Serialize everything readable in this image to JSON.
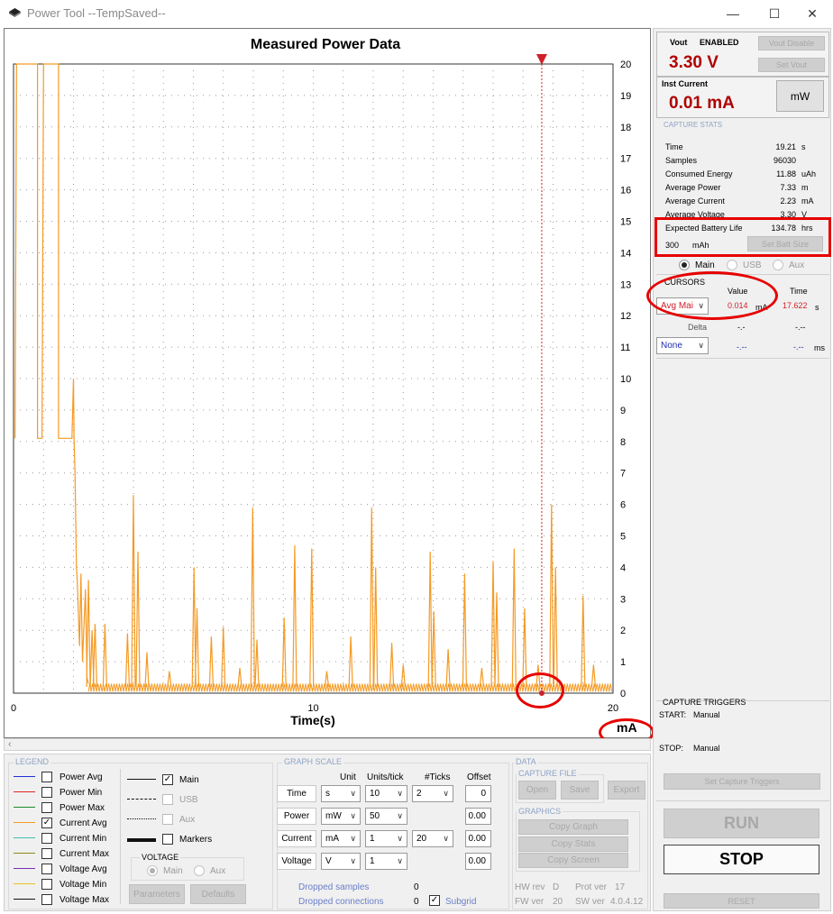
{
  "window": {
    "title": "Power Tool --TempSaved--",
    "minimize": "—",
    "maximize": "☐",
    "close": "✕"
  },
  "graph": {
    "title": "Measured Power Data",
    "unit_label": "mA",
    "x_title": "Time(s)"
  },
  "chart_data": {
    "type": "line",
    "title": "Measured Power Data",
    "xlabel": "Time(s)",
    "ylabel": "mA",
    "xlim": [
      0,
      20
    ],
    "ylim": [
      0,
      20
    ],
    "x_ticks": [
      "0",
      "10",
      "20"
    ],
    "y_ticks": [
      "0",
      "1",
      "2",
      "3",
      "4",
      "5",
      "6",
      "7",
      "8",
      "9",
      "10",
      "11",
      "12",
      "13",
      "14",
      "15",
      "16",
      "17",
      "18",
      "19",
      "20"
    ],
    "grid": true,
    "legend": "none",
    "series_color": "#f59a23",
    "cursor_color": "#d0202a",
    "cursor_x": 17.622,
    "baseline_mA": 0.3,
    "series": [
      {
        "x": [
          0.05,
          0.1,
          0.12,
          0.2,
          0.55,
          0.8,
          0.8,
          0.83,
          0.95,
          1.0,
          1.5,
          1.5,
          1.55,
          1.95,
          2.0,
          2.02,
          2.05,
          2.1,
          2.13,
          2.2,
          2.25,
          2.3,
          2.4,
          2.45,
          2.5
        ],
        "y": [
          8.1,
          20,
          20,
          20,
          20,
          20,
          8.1,
          8.1,
          8.1,
          20,
          20,
          8.1,
          8.1,
          8.1,
          10,
          8.0,
          7.0,
          4.0,
          3.5,
          1.5,
          3.8,
          1.0,
          3.3,
          0.5,
          0.3
        ]
      }
    ],
    "spikes": [
      {
        "x": 2.5,
        "y": 3.6
      },
      {
        "x": 2.62,
        "y": 2.0
      },
      {
        "x": 2.72,
        "y": 2.2
      },
      {
        "x": 3.05,
        "y": 2.2
      },
      {
        "x": 3.8,
        "y": 1.9
      },
      {
        "x": 4.0,
        "y": 6.3
      },
      {
        "x": 4.15,
        "y": 4.5
      },
      {
        "x": 4.45,
        "y": 1.3
      },
      {
        "x": 5.2,
        "y": 0.7
      },
      {
        "x": 6.02,
        "y": 4.0
      },
      {
        "x": 6.12,
        "y": 2.7
      },
      {
        "x": 6.6,
        "y": 1.8
      },
      {
        "x": 7.0,
        "y": 2.1
      },
      {
        "x": 7.55,
        "y": 0.8
      },
      {
        "x": 7.98,
        "y": 5.9
      },
      {
        "x": 8.12,
        "y": 1.7
      },
      {
        "x": 9.03,
        "y": 2.4
      },
      {
        "x": 9.38,
        "y": 4.7
      },
      {
        "x": 9.95,
        "y": 4.6
      },
      {
        "x": 10.45,
        "y": 0.7
      },
      {
        "x": 11.25,
        "y": 1.8
      },
      {
        "x": 11.95,
        "y": 5.9
      },
      {
        "x": 12.08,
        "y": 4.0
      },
      {
        "x": 12.62,
        "y": 1.6
      },
      {
        "x": 13.0,
        "y": 0.9
      },
      {
        "x": 13.9,
        "y": 4.5
      },
      {
        "x": 14.02,
        "y": 2.6
      },
      {
        "x": 14.5,
        "y": 1.4
      },
      {
        "x": 15.05,
        "y": 3.8
      },
      {
        "x": 15.62,
        "y": 0.8
      },
      {
        "x": 16.0,
        "y": 4.2
      },
      {
        "x": 16.12,
        "y": 3.2
      },
      {
        "x": 16.7,
        "y": 4.6
      },
      {
        "x": 17.05,
        "y": 2.7
      },
      {
        "x": 17.5,
        "y": 0.9
      },
      {
        "x": 17.95,
        "y": 6.0
      },
      {
        "x": 18.08,
        "y": 4.0
      },
      {
        "x": 19.0,
        "y": 3.1
      },
      {
        "x": 19.35,
        "y": 0.9
      }
    ]
  },
  "legend": {
    "group_label": "LEGEND",
    "items": [
      {
        "label": "Power Avg",
        "color": "#1f2fd6",
        "style": "solid",
        "checked": false
      },
      {
        "label": "Power Min",
        "color": "#e0241f",
        "style": "solid",
        "checked": false
      },
      {
        "label": "Power Max",
        "color": "#1a8a2a",
        "style": "solid",
        "checked": false
      },
      {
        "label": "Current Avg",
        "color": "#f59a23",
        "style": "solid",
        "checked": true
      },
      {
        "label": "Current Min",
        "color": "#3fbfb0",
        "style": "solid",
        "checked": false
      },
      {
        "label": "Current Max",
        "color": "#8a8a1a",
        "style": "solid",
        "checked": false
      },
      {
        "label": "Voltage Avg",
        "color": "#7a2fb8",
        "style": "solid",
        "checked": false
      },
      {
        "label": "Voltage Min",
        "color": "#e8c21a",
        "style": "solid",
        "checked": false
      },
      {
        "label": "Voltage Max",
        "color": "#111111",
        "style": "solid",
        "checked": false
      }
    ],
    "channels": [
      {
        "label": "Main",
        "style": "solid",
        "checked": true,
        "disabled": false
      },
      {
        "label": "USB",
        "style": "dashed",
        "checked": false,
        "disabled": true
      },
      {
        "label": "Aux",
        "style": "dotted",
        "checked": false,
        "disabled": true
      },
      {
        "label": "Markers",
        "style": "thick",
        "checked": false,
        "disabled": false
      }
    ],
    "voltage_label": "VOLTAGE",
    "voltage_main": "Main",
    "voltage_aux": "Aux",
    "parameters_button": "Parameters",
    "defaults_button": "Defaults"
  },
  "graph_scale": {
    "group_label": "GRAPH SCALE",
    "headers": {
      "unit": "Unit",
      "units_per_tick": "Units/tick",
      "ticks": "#Ticks",
      "offset": "Offset"
    },
    "rows": [
      {
        "label": "Time",
        "unit": "s",
        "units_per_tick": "10",
        "ticks": "2",
        "offset": "0"
      },
      {
        "label": "Power",
        "unit": "mW",
        "units_per_tick": "50",
        "ticks": "",
        "offset": "0.00"
      },
      {
        "label": "Current",
        "unit": "mA",
        "units_per_tick": "1",
        "ticks": "20",
        "offset": "0.00"
      },
      {
        "label": "Voltage",
        "unit": "V",
        "units_per_tick": "1",
        "ticks": "",
        "offset": "0.00"
      }
    ],
    "dropped_samples_label": "Dropped samples",
    "dropped_samples_value": "0",
    "dropped_connections_label": "Dropped connections",
    "dropped_connections_value": "0",
    "subgrid_label": "Subgrid",
    "subgrid_checked": true
  },
  "data_panel": {
    "group_label": "DATA",
    "capture_file_label": "CAPTURE FILE",
    "open_button": "Open",
    "save_button": "Save",
    "export_button": "Export",
    "graphics_label": "GRAPHICS",
    "copy_graph_button": "Copy Graph",
    "copy_stats_button": "Copy Stats",
    "copy_screen_button": "Copy Screen",
    "hw_rev_label": "HW rev",
    "hw_rev_value": "D",
    "prot_ver_label": "Prot ver",
    "prot_ver_value": "17",
    "fw_ver_label": "FW ver",
    "fw_ver_value": "20",
    "sw_ver_label": "SW ver",
    "sw_ver_value": "4.0.4.12"
  },
  "right": {
    "vout_label": "Vout",
    "vout_status": "ENABLED",
    "vout_value": "3.30  V",
    "vout_disable_button": "Vout Disable",
    "set_vout_button": "Set Vout",
    "inst_current_label": "Inst Current",
    "inst_current_value": "0.01  mA",
    "mw_button": "mW",
    "capture_stats_label": "CAPTURE STATS",
    "stats": [
      {
        "key": "Time",
        "value": "19.21",
        "unit": "s"
      },
      {
        "key": "Samples",
        "value": "96030",
        "unit": ""
      },
      {
        "key": "Consumed Energy",
        "value": "11.88",
        "unit": "uAh"
      },
      {
        "key": "Average Power",
        "value": "7.33",
        "unit": "m"
      },
      {
        "key": "Average Current",
        "value": "2.23",
        "unit": "mA"
      },
      {
        "key": "Average Voltage",
        "value": "3.30",
        "unit": "V"
      }
    ],
    "battery_life_label": "Expected Battery Life",
    "battery_life_value": "134.78",
    "battery_life_unit": "hrs",
    "battery_capacity_value": "300",
    "battery_capacity_unit": "mAh",
    "set_batt_size_button": "Set Batt Size",
    "channel_main": "Main",
    "channel_usb": "USB",
    "channel_aux": "Aux",
    "cursors_label": "CURSORS",
    "value_header": "Value",
    "time_header": "Time",
    "cursor1_select": "Avg Mai",
    "cursor1_value": "0.014",
    "cursor1_unit": "mA",
    "cursor1_time": "17.622",
    "cursor1_time_unit": "s",
    "delta_label": "Delta",
    "delta_value": "-.-",
    "delta_time": "-.--",
    "cursor2_select": "None",
    "cursor2_value": "-.--",
    "cursor2_time": "-.--",
    "cursor2_time_unit": "ms",
    "capture_triggers_label": "CAPTURE TRIGGERS",
    "start_label": "START:",
    "start_value": "Manual",
    "stop_label": "STOP:",
    "stop_value": "Manual",
    "set_triggers_button": "Set Capture Triggers",
    "run_button": "RUN",
    "stop_button": "STOP",
    "reset_button": "RESET"
  }
}
